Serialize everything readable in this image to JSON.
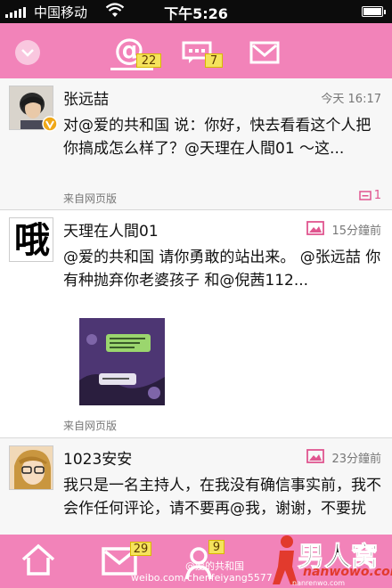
{
  "status_bar": {
    "carrier": "中国移动",
    "time": "下午5:26",
    "battery_level": 1.0
  },
  "top_tabs": [
    {
      "name": "at-mentions",
      "icon": "at-icon",
      "badge": "22",
      "selected": true
    },
    {
      "name": "comments",
      "icon": "comment-icon",
      "badge": "7"
    },
    {
      "name": "messages",
      "icon": "envelope-icon"
    }
  ],
  "posts": [
    {
      "username": "张远喆",
      "time": "今天 16:17",
      "content": "对@爱的共和国 说：你好，快去看看这个人把你搞成怎么样了？@天理在人間01 ～这...",
      "source": "来自网页版",
      "comment_count": "1",
      "verified": true
    },
    {
      "username": "天理在人間01",
      "time": "15分鐘前",
      "content": "@爱的共和国 请你勇敢的站出来。 @张远喆 你有种抛弃你老婆孩子 和@倪茜112...",
      "source": "来自网页版",
      "avatar_text": "哦",
      "has_image": true
    },
    {
      "username": "1023安安",
      "time": "23分鐘前",
      "content": "我只是一名主持人，在我没有确信事实前，我不会作任何评论，请不要再@我，谢谢，不要扰",
      "has_image": true
    }
  ],
  "bottom_nav": [
    {
      "name": "home",
      "icon": "home-icon"
    },
    {
      "name": "mail",
      "icon": "mail-icon",
      "badge": "29"
    },
    {
      "name": "profile",
      "icon": "user-icon",
      "badge": "9"
    }
  ],
  "watermark": {
    "handle": "@爱的共和国",
    "url": "weibo.com/chenfeiyang5577"
  },
  "logo": {
    "title": "男人窝",
    "domain": "nanwowo.com",
    "sub": "nanrenwo.com"
  },
  "colors": {
    "brand_pink": "#f283b9",
    "badge_yellow": "#f5e35c",
    "accent_pink": "#e0558f"
  }
}
